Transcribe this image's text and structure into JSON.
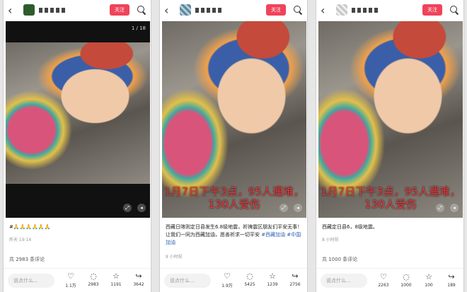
{
  "posts": [
    {
      "follow_label": "关注",
      "counter": "1 / 18",
      "caption": "",
      "description": "#🙏🙏🙏🙏🙏🙏",
      "tags": "",
      "time": "昨天 19:14",
      "comments_count": "共 2983 条评论",
      "comment_placeholder": "说点什么...",
      "likes": "1.1万",
      "comments": "2983",
      "favorites": "1191",
      "shares": "3642"
    },
    {
      "follow_label": "关注",
      "counter": "",
      "caption": "1月7日下午3点，95人遇难，130人受伤",
      "description": "西藏日喀则定日县发生6.8级地震，祈祷震区朋友们平安无事！让我们一同为西藏加油，愿善祈求一切平安",
      "tags": "#西藏加油 #中国加油",
      "time": "8 小时前",
      "comments_count": "",
      "comment_placeholder": "说点什么...",
      "likes": "1.9万",
      "comments": "5425",
      "favorites": "1239",
      "shares": "2756"
    },
    {
      "follow_label": "关注",
      "counter": "",
      "caption": "1月7日下午3点，95人遇难，130人受伤",
      "description": "西藏定日县6，8级地震。",
      "tags": "",
      "time": "8 小时前",
      "comments_count": "共 1000 条评论",
      "comment_placeholder": "说点什么...",
      "likes": "2263",
      "comments": "1000",
      "favorites": "100",
      "shares": "189"
    }
  ],
  "icons": {
    "back": "chevron-left-icon",
    "search": "search-icon",
    "like": "heart-icon",
    "comment": "comment-icon",
    "favorite": "star-icon",
    "share": "share-icon"
  },
  "colors": {
    "follow": "#f0435a",
    "caption": "#e8373c",
    "tag": "#2f5fb3"
  }
}
